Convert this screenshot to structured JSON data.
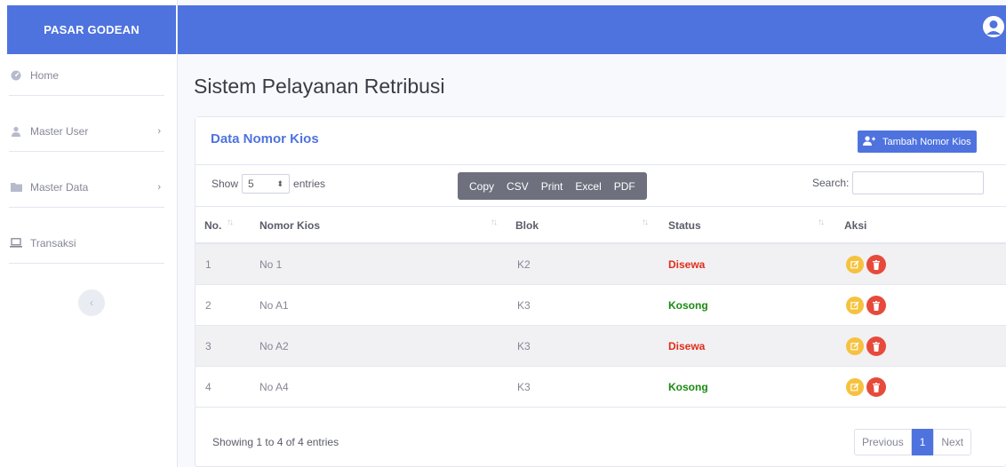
{
  "brand": "PASAR GODEAN",
  "sidebar": {
    "items": [
      {
        "label": "Home",
        "icon": "dashboard-icon"
      },
      {
        "label": "Master User",
        "icon": "user-icon"
      },
      {
        "label": "Master Data",
        "icon": "folder-icon"
      },
      {
        "label": "Transaksi",
        "icon": "laptop-icon"
      }
    ]
  },
  "page_title": "Sistem Pelayanan Retribusi",
  "card": {
    "title": "Data Nomor Kios",
    "add_button": "Tambah Nomor Kios"
  },
  "controls": {
    "show_label": "Show",
    "entries_value": "5",
    "entries_label": "entries",
    "export_buttons": [
      "Copy",
      "CSV",
      "Print",
      "Excel",
      "PDF"
    ],
    "search_label": "Search:",
    "search_value": ""
  },
  "table": {
    "columns": [
      "No.",
      "Nomor Kios",
      "Blok",
      "Status",
      "Aksi"
    ],
    "rows": [
      {
        "no": "1",
        "nomor": "No 1",
        "blok": "K2",
        "status": "Disewa"
      },
      {
        "no": "2",
        "nomor": "No A1",
        "blok": "K3",
        "status": "Kosong"
      },
      {
        "no": "3",
        "nomor": "No A2",
        "blok": "K3",
        "status": "Disewa"
      },
      {
        "no": "4",
        "nomor": "No A4",
        "blok": "K3",
        "status": "Kosong"
      }
    ]
  },
  "footer": {
    "info": "Showing 1 to 4 of 4 entries",
    "previous": "Previous",
    "page": "1",
    "next": "Next"
  },
  "colors": {
    "primary": "#4e73df",
    "disewa": "#e02d1b",
    "kosong": "#1a8a13",
    "edit": "#f6c23e",
    "delete": "#e74a3b"
  }
}
